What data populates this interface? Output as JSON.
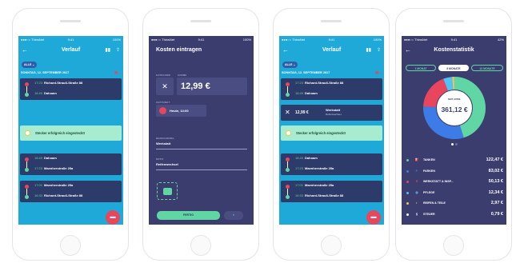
{
  "status": {
    "carrier": "●●●○○ ThinsNet",
    "time": "9:41",
    "battery": "100%",
    "battery4": "42%"
  },
  "s1": {
    "title": "Verlauf",
    "filter": "ALLE ⌄",
    "date": "SONNTAG, 12. SEPTEMBER 2017",
    "trip1": {
      "t1": "17:23",
      "p1": "Richard-Strauß-Straße 88",
      "t2": "18:49",
      "p2": "Dahoam"
    },
    "notice": "Stecker erfolgreich eingesteckt!",
    "trip2": {
      "t1": "18:49",
      "p1": "Dahoam",
      "t2": "17:23",
      "p2": "Maenherstraße 25a"
    },
    "trip3": {
      "t1": "17:01",
      "p1": "Maenherstraße 25a",
      "t2": "16:33",
      "p2": "Richard-Strauß-Straße 88"
    }
  },
  "s2": {
    "title": "Kosten eintragen",
    "cat_label": "KATEGORIE",
    "sum_label": "SUMME",
    "sum": "12,99 €",
    "time_label": "ZEITPUNKT",
    "time": "Heute, 14:00",
    "desc_label": "BEZEICHNUNG",
    "desc": "Werkstatt",
    "note_label": "NOTIZ",
    "note": "Reifenwechsel",
    "done": "FERTIG",
    "cancel": "×"
  },
  "s3": {
    "title": "Verlauf",
    "filter": "ALLE ⌄",
    "date": "SONNTAG, 12. SEPTEMBER 2017",
    "trip1": {
      "t1": "17:23",
      "p1": "Richard-Strauß-Straße 88",
      "t2": "18:49",
      "p2": "Dahoam"
    },
    "cost": {
      "sum": "12,99 €",
      "name": "Werkstatt",
      "note": "Reifenwechsel"
    },
    "notice": "Stecker erfolgreich eingesteckt!",
    "trip2": {
      "t1": "18:49",
      "p1": "Dahoam",
      "t2": "17:23",
      "p2": "Maenherstraße 25a"
    },
    "trip3": {
      "t1": "17:01",
      "p1": "Maenherstraße 25a",
      "t2": "16:33",
      "p2": "Richard-Strauß-Straße 88"
    }
  },
  "s4": {
    "title": "Kostenstatistik",
    "tabs": [
      "1 MONAT",
      "6 MONATE",
      "12 MONATE"
    ],
    "center_label": "SEIT APRIL",
    "total": "361,12 €",
    "stats": [
      {
        "name": "TANKEN",
        "value": "122,47 €",
        "color": "#5fd6a3"
      },
      {
        "name": "PARKEN",
        "value": "83,02 €",
        "color": "#3d7be6"
      },
      {
        "name": "WERKSTATT & INSP...",
        "value": "50,13 €",
        "color": "#e8465d"
      },
      {
        "name": "PFLEGE",
        "value": "12,34 €",
        "color": "#4fc3f7"
      },
      {
        "name": "REIFEN & TEILE",
        "value": "2,97 €",
        "color": "#f2c94c"
      },
      {
        "name": "STEUER",
        "value": "0,79 €",
        "color": "#ffffff"
      }
    ]
  }
}
